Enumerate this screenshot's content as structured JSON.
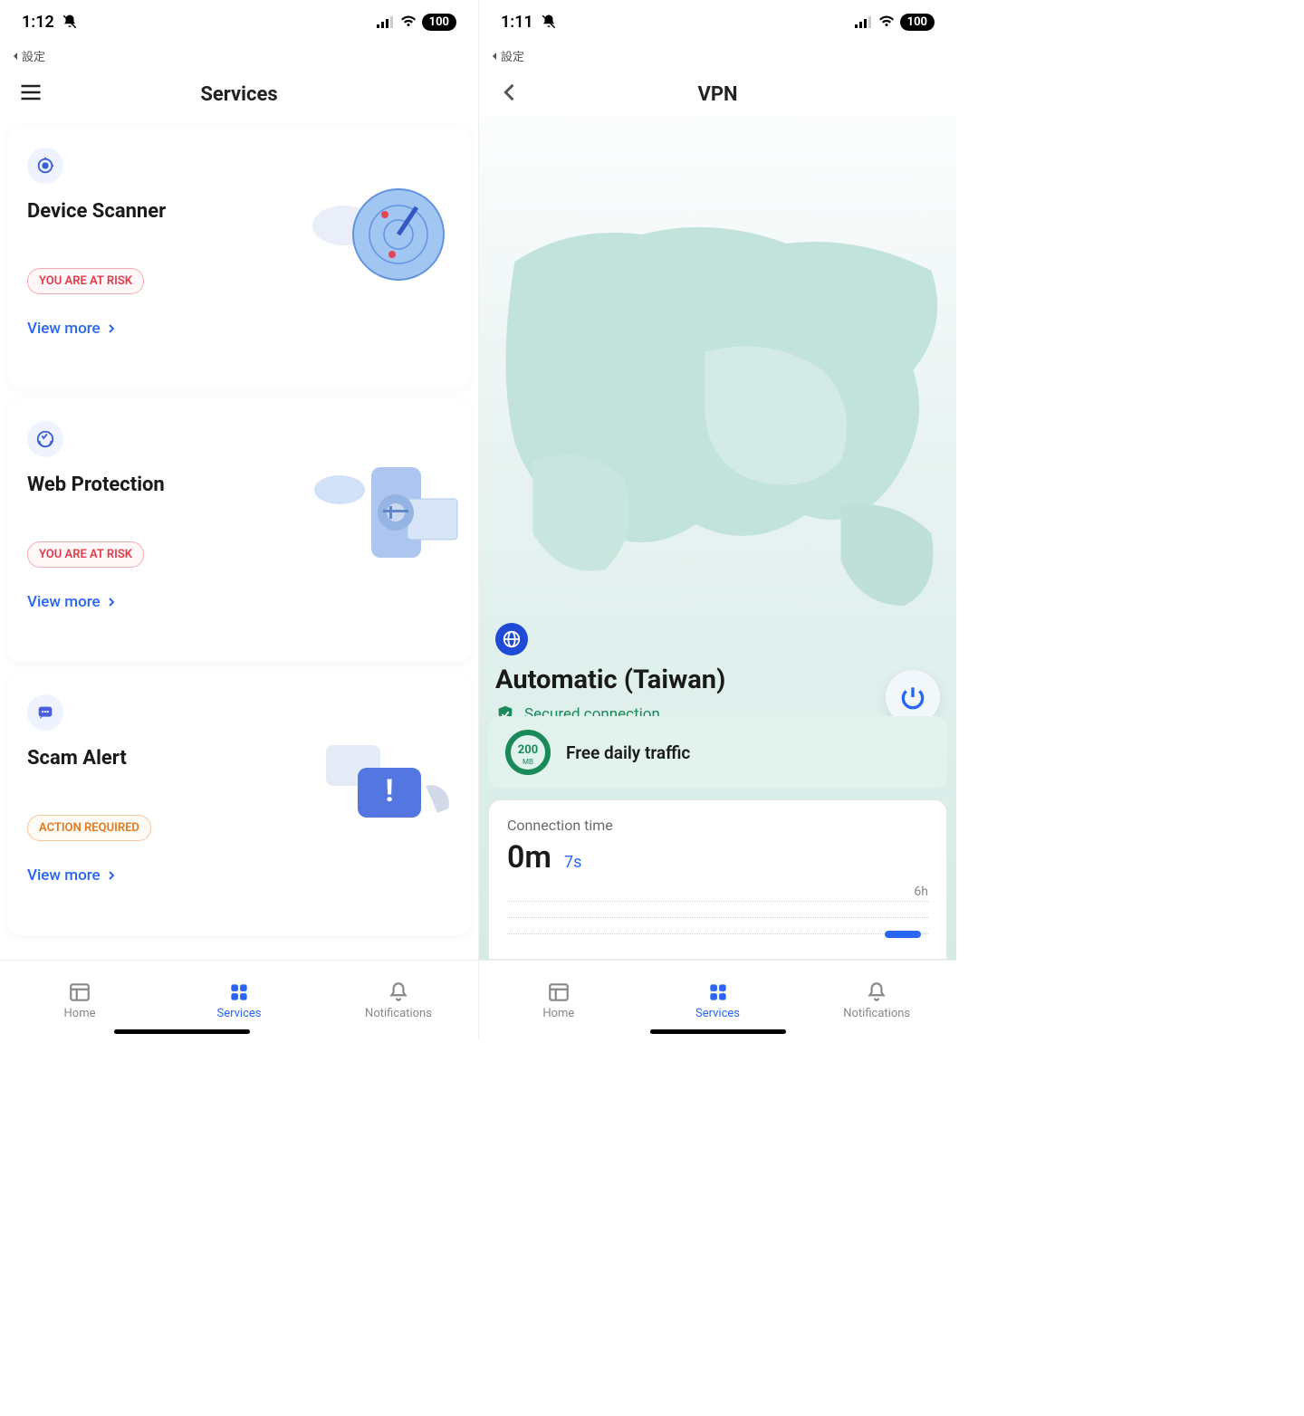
{
  "left": {
    "status": {
      "time": "1:12",
      "back_app": "設定",
      "battery": "100"
    },
    "header": {
      "title": "Services"
    },
    "cards": [
      {
        "title": "Device Scanner",
        "badge": "YOU ARE AT RISK",
        "badge_type": "risk",
        "link": "View more"
      },
      {
        "title": "Web Protection",
        "badge": "YOU ARE AT RISK",
        "badge_type": "risk",
        "link": "View more"
      },
      {
        "title": "Scam Alert",
        "badge": "ACTION REQUIRED",
        "badge_type": "action",
        "link": "View more"
      }
    ],
    "tabs": {
      "home": "Home",
      "services": "Services",
      "notifications": "Notifications"
    }
  },
  "right": {
    "status": {
      "time": "1:11",
      "back_app": "設定",
      "battery": "100"
    },
    "header": {
      "title": "VPN"
    },
    "location": {
      "title": "Automatic (Taiwan)",
      "status": "Secured connection"
    },
    "traffic": {
      "amount": "200",
      "unit": "MB",
      "label": "Free daily traffic"
    },
    "connection": {
      "title": "Connection time",
      "main": "0m",
      "seconds": "7s",
      "axis_max": "6h"
    },
    "tabs": {
      "home": "Home",
      "services": "Services",
      "notifications": "Notifications"
    }
  }
}
